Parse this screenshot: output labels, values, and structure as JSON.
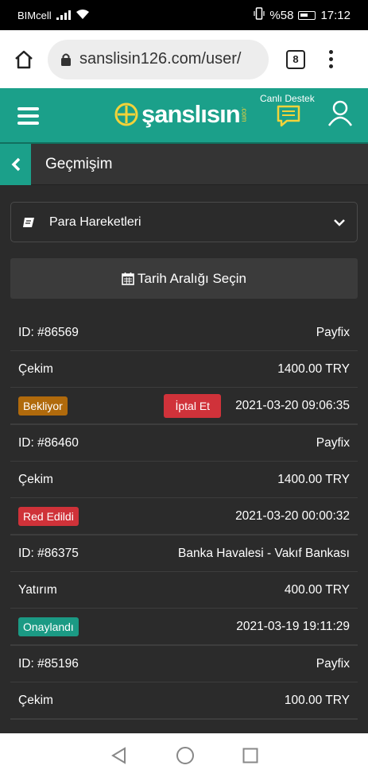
{
  "status_bar": {
    "carrier": "BIMcell",
    "battery": "%58",
    "time": "17:12"
  },
  "browser": {
    "url": "sanslisin126.com/user/",
    "tab_count": "8"
  },
  "site": {
    "logo_text": "şanslısın",
    "logo_suffix": ".com",
    "support_label": "Canlı Destek",
    "brand_color": "#1ba08a"
  },
  "page": {
    "title": "Geçmişim"
  },
  "filter": {
    "dropdown_value": "Para Hareketleri",
    "date_range_label": "Tarih Aralığı Seçin"
  },
  "transactions": [
    {
      "id": "ID: #86569",
      "method": "Payfix",
      "type": "Çekim",
      "amount": "1400.00 TRY",
      "status": "Bekliyor",
      "status_color": "#b06a0c",
      "cancel_label": "İptal Et",
      "datetime": "2021-03-20 09:06:35"
    },
    {
      "id": "ID: #86460",
      "method": "Payfix",
      "type": "Çekim",
      "amount": "1400.00 TRY",
      "status": "Red Edildi",
      "status_color": "#cf3239",
      "datetime": "2021-03-20 00:00:32"
    },
    {
      "id": "ID: #86375",
      "method": "Banka Havalesi - Vakıf Bankası",
      "type": "Yatırım",
      "amount": "400.00 TRY",
      "status": "Onaylandı",
      "status_color": "#1b9a84",
      "datetime": "2021-03-19 19:11:29"
    },
    {
      "id": "ID: #85196",
      "method": "Payfix",
      "type": "Çekim",
      "amount": "100.00 TRY"
    }
  ]
}
